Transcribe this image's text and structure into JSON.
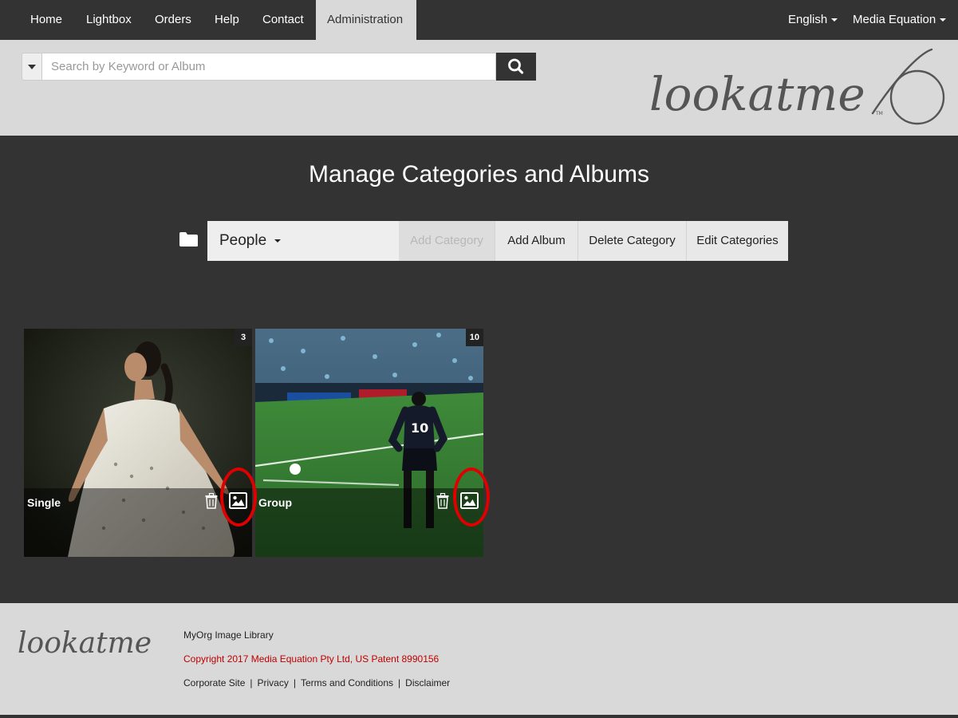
{
  "nav": {
    "items": [
      "Home",
      "Lightbox",
      "Orders",
      "Help",
      "Contact",
      "Administration"
    ],
    "active": "Administration",
    "language": "English",
    "account": "Media Equation"
  },
  "search": {
    "placeholder": "Search by Keyword or Album",
    "value": ""
  },
  "brand": {
    "logo_text": "lookatme",
    "trademark": "TM"
  },
  "page": {
    "title": "Manage Categories and Albums"
  },
  "category_bar": {
    "selected": "People",
    "buttons": {
      "add_category": "Add Category",
      "add_album": "Add Album",
      "delete_category": "Delete Category",
      "edit_categories": "Edit Categories"
    },
    "add_category_disabled": true
  },
  "albums": [
    {
      "name": "Single",
      "count": "3"
    },
    {
      "name": "Group",
      "count": "10"
    }
  ],
  "annotation_color": "#e00000",
  "footer": {
    "org": "MyOrg Image Library",
    "copyright": "Copyright 2017 Media Equation Pty Ltd, US Patent 8990156",
    "links": [
      "Corporate Site",
      "Privacy",
      "Terms and Conditions",
      "Disclaimer"
    ]
  },
  "colors": {
    "dark": "#333333",
    "light_band": "#d9d9d9",
    "copyright_red": "#c00000"
  }
}
